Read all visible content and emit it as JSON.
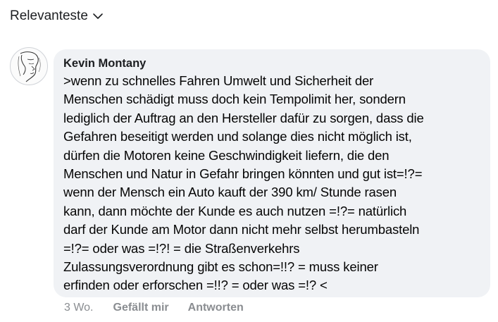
{
  "sort": {
    "label": "Relevanteste",
    "icon": "chevron-down-icon"
  },
  "comment": {
    "avatar_icon": "profile-sketch-avatar",
    "author": "Kevin Montany",
    "text": ">wenn zu schnelles Fahren Umwelt und Sicherheit der\nMenschen schädigt muss doch kein Tempolimit her, sondern\nlediglich der Auftrag an den Hersteller dafür zu sorgen, dass die\nGefahren beseitigt werden und solange dies nicht möglich ist,\ndürfen die Motoren keine Geschwindigkeit liefern, die den\nMenschen und Natur  in Gefahr bringen könnten und gut ist=!?=\nwenn der Mensch ein Auto kauft der 390 km/ Stunde rasen\nkann, dann möchte der Kunde es auch nutzen =!?= natürlich\ndarf der Kunde am Motor dann nicht mehr selbst herumbasteln\n=!?= oder was =!?! = die Straßenverkehrs\nZulassungsverordnung gibt es schon=!!? = muss keiner\nerfinden oder erforschen =!!? = oder was =!? <",
    "time": "3 Wo.",
    "like_label": "Gefällt mir",
    "reply_label": "Antworten"
  },
  "colors": {
    "bubble_bg": "#f0f2f5",
    "meta_text": "#8a8d91",
    "body_text": "#050505"
  }
}
